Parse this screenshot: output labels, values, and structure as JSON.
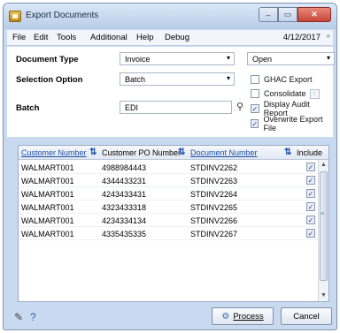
{
  "window": {
    "title": "Export Documents",
    "controls": {
      "minimize": "–",
      "maximize": "▭",
      "close": "✕"
    }
  },
  "menu": {
    "items": [
      "File",
      "Edit",
      "Tools",
      "Additional",
      "Help",
      "Debug"
    ],
    "date": "4/12/2017",
    "overflow": "»"
  },
  "form": {
    "document_type": {
      "label": "Document Type",
      "value": "Invoice",
      "status": "Open"
    },
    "selection_option": {
      "label": "Selection Option",
      "value": "Batch"
    },
    "batch": {
      "label": "Batch",
      "value": "EDI"
    },
    "options": [
      {
        "label": "GHAC Export",
        "checked": false
      },
      {
        "label": "Consolidate",
        "checked": false
      },
      {
        "label": "Display Audit Report",
        "checked": true
      },
      {
        "label": "Overwrite Export File",
        "checked": true
      }
    ]
  },
  "grid": {
    "headers": {
      "customer": "Customer Number",
      "po": "Customer PO Number",
      "doc": "Document Number",
      "include": "Include"
    },
    "rows": [
      {
        "customer": "WALMART001",
        "po": "4988984443",
        "doc": "STDINV2262",
        "include": true
      },
      {
        "customer": "WALMART001",
        "po": "4344433231",
        "doc": "STDINV2263",
        "include": true
      },
      {
        "customer": "WALMART001",
        "po": "4243433431",
        "doc": "STDINV2264",
        "include": true
      },
      {
        "customer": "WALMART001",
        "po": "4323433318",
        "doc": "STDINV2265",
        "include": true
      },
      {
        "customer": "WALMART001",
        "po": "4234334134",
        "doc": "STDINV2266",
        "include": true
      },
      {
        "customer": "WALMART001",
        "po": "4335435335",
        "doc": "STDINV2267",
        "include": true
      }
    ]
  },
  "buttons": {
    "process": "Process",
    "cancel": "Cancel"
  }
}
